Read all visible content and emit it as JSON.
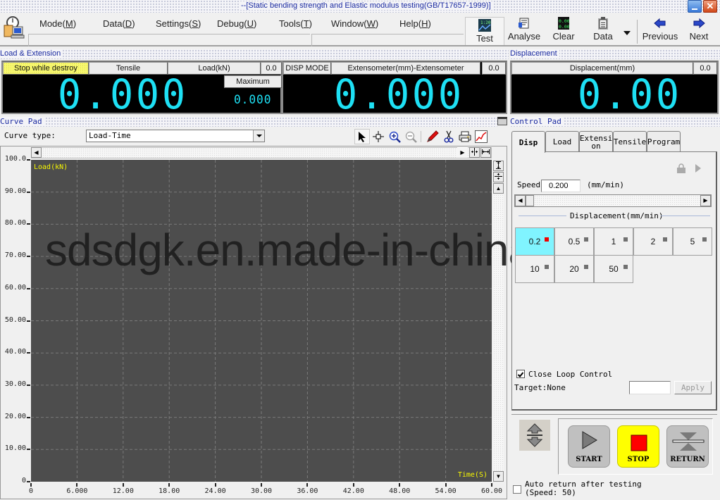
{
  "window": {
    "title": "--[Static bending strength and Elastic modulus testing(GB/T17657-1999)]"
  },
  "menu": [
    {
      "label": "Mode(",
      "key": "M",
      "end": ")"
    },
    {
      "label": "Data(",
      "key": "D",
      "end": ")"
    },
    {
      "label": "Settings(",
      "key": "S",
      "end": ")"
    },
    {
      "label": "Debug(",
      "key": "U",
      "end": ")"
    },
    {
      "label": "Tools(",
      "key": "T",
      "end": ")"
    },
    {
      "label": "Window(",
      "key": "W",
      "end": ")"
    },
    {
      "label": "Help(",
      "key": "H",
      "end": ")"
    }
  ],
  "toolbar": {
    "test": "Test",
    "analyse": "Analyse",
    "clear": "Clear",
    "data": "Data",
    "previous": "Previous",
    "next": "Next"
  },
  "load_extension": {
    "title": "Load & Extension",
    "stop_mode": "Stop while destroy",
    "test_type": "Tensile",
    "channel": "Load(kN)",
    "range": "0.0",
    "maximum_label": "Maximum",
    "value": "0.000",
    "maximum_value": "0.000",
    "disp_mode": "DISP MODE",
    "ext_channel": "Extensometer(mm)-Extensometer",
    "ext_range": "0.0",
    "ext_value": "0.000"
  },
  "displacement": {
    "title": "Displacement",
    "channel": "Displacement(mm)",
    "range": "0.0",
    "value": "0.00"
  },
  "curve_pad": {
    "title": "Curve Pad",
    "curve_type_label": "Curve type:",
    "curve_type_value": "Load-Time",
    "y_label": "Load(kN)",
    "x_label": "Time(S)"
  },
  "chart_data": {
    "type": "line",
    "title": "",
    "xlabel": "Time(S)",
    "ylabel": "Load(kN)",
    "xlim": [
      0,
      60
    ],
    "ylim": [
      0,
      100
    ],
    "grid": true,
    "x_ticks": [
      "0",
      "6.000",
      "12.00",
      "18.00",
      "24.00",
      "30.00",
      "36.00",
      "42.00",
      "48.00",
      "54.00",
      "60.00"
    ],
    "y_ticks": [
      "0",
      "10.00",
      "20.00",
      "30.00",
      "40.00",
      "50.00",
      "60.00",
      "70.00",
      "80.00",
      "90.00",
      "100.0"
    ],
    "series": []
  },
  "control_pad": {
    "title": "Control Pad",
    "tabs": [
      "Disp",
      "Load",
      "Extensi\non",
      "Tensile",
      "Program"
    ],
    "active_tab": "Disp",
    "speed_label": "Speed",
    "speed_value": "0.200",
    "speed_unit": "(mm/min)",
    "speed_group_label": "Displacement(mm/min)",
    "speed_presets": [
      "0.2",
      "0.5",
      "1",
      "2",
      "5",
      "10",
      "20",
      "50"
    ],
    "selected_preset": "0.2",
    "close_loop_label": "Close Loop Control",
    "close_loop_checked": true,
    "target_label": "Target:None",
    "target_value": "",
    "apply_label": "Apply",
    "start_label": "START",
    "stop_label": "STOP",
    "return_label": "RETURN",
    "auto_return_label": "Auto return after testing",
    "auto_return_speed": "(Speed: 50)",
    "auto_return_checked": false
  },
  "watermark": "sdsdgk.en.made-in-china.com"
}
